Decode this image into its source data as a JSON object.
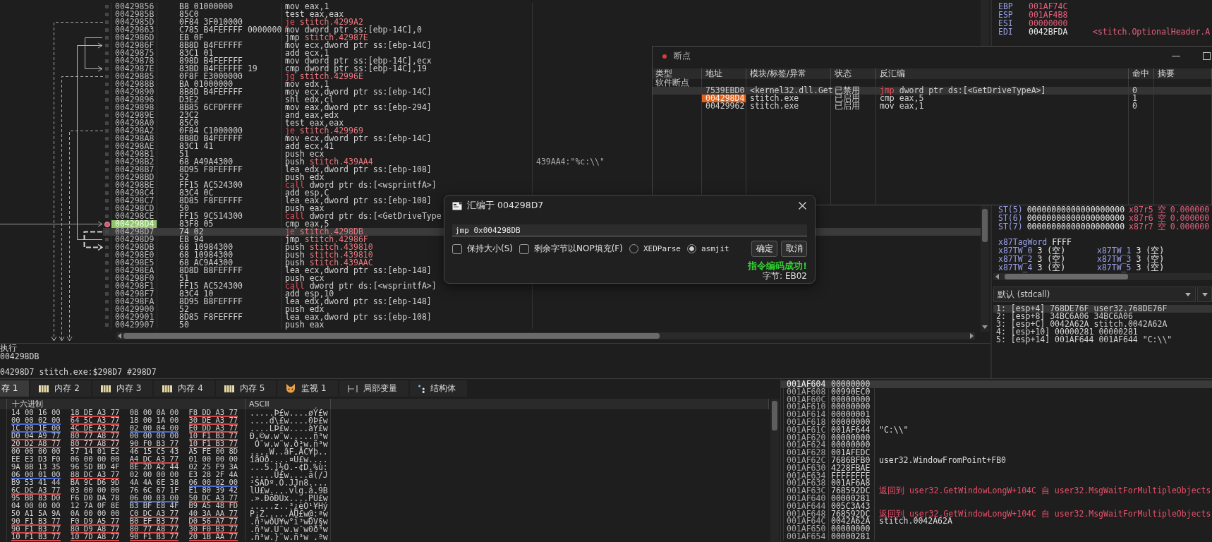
{
  "disassembly": {
    "rows": [
      {
        "address": "00429856",
        "bytes": "B8 01000000",
        "mnemonic": "mov",
        "operands": "eax,1",
        "kind": "plain",
        "breakpoint": false,
        "highlighted": false,
        "selected": false
      },
      {
        "address": "0042985B",
        "bytes": "85C0",
        "mnemonic": "test",
        "operands": "eax,eax",
        "kind": "plain",
        "breakpoint": false,
        "highlighted": false,
        "selected": false
      },
      {
        "address": "0042985D",
        "bytes": "0F84 3F010000",
        "mnemonic": "je",
        "operands": "stitch.4299A2",
        "kind": "cond_jump",
        "breakpoint": false,
        "highlighted": false,
        "selected": false
      },
      {
        "address": "00429863",
        "bytes": "C785 B4FEFFFF 0000000",
        "mnemonic": "mov",
        "operands": "dword ptr ss:[ebp-14C],0",
        "kind": "plain",
        "breakpoint": false,
        "highlighted": false,
        "selected": false
      },
      {
        "address": "0042986D",
        "bytes": "EB 0F",
        "mnemonic": "jmp",
        "operands": "stitch.42987E",
        "kind": "jump",
        "breakpoint": false,
        "highlighted": false,
        "selected": false
      },
      {
        "address": "0042986F",
        "bytes": "8B8D B4FEFFFF",
        "mnemonic": "mov",
        "operands": "ecx,dword ptr ss:[ebp-14C]",
        "kind": "plain",
        "breakpoint": false,
        "highlighted": false,
        "selected": false
      },
      {
        "address": "00429875",
        "bytes": "83C1 01",
        "mnemonic": "add",
        "operands": "ecx,1",
        "kind": "plain",
        "breakpoint": false,
        "highlighted": false,
        "selected": false
      },
      {
        "address": "00429878",
        "bytes": "898D B4FEFFFF",
        "mnemonic": "mov",
        "operands": "dword ptr ss:[ebp-14C],ecx",
        "kind": "plain",
        "breakpoint": false,
        "highlighted": false,
        "selected": false
      },
      {
        "address": "0042987E",
        "bytes": "83BD B4FEFFFF 19",
        "mnemonic": "cmp",
        "operands": "dword ptr ss:[ebp-14C],19",
        "kind": "plain",
        "breakpoint": false,
        "highlighted": false,
        "selected": false
      },
      {
        "address": "00429885",
        "bytes": "0F8F E3000000",
        "mnemonic": "jg",
        "operands": "stitch.42996E",
        "kind": "cond_jump",
        "breakpoint": false,
        "highlighted": false,
        "selected": false
      },
      {
        "address": "0042988B",
        "bytes": "BA 01000000",
        "mnemonic": "mov",
        "operands": "edx,1",
        "kind": "plain",
        "breakpoint": false,
        "highlighted": false,
        "selected": false
      },
      {
        "address": "00429890",
        "bytes": "8B8D B4FEFFFF",
        "mnemonic": "mov",
        "operands": "ecx,dword ptr ss:[ebp-14C]",
        "kind": "plain",
        "breakpoint": false,
        "highlighted": false,
        "selected": false
      },
      {
        "address": "00429896",
        "bytes": "D3E2",
        "mnemonic": "shl",
        "operands": "edx,cl",
        "kind": "plain",
        "breakpoint": false,
        "highlighted": false,
        "selected": false
      },
      {
        "address": "00429898",
        "bytes": "8B85 6CFDFFFF",
        "mnemonic": "mov",
        "operands": "eax,dword ptr ss:[ebp-294]",
        "kind": "plain",
        "breakpoint": false,
        "highlighted": false,
        "selected": false
      },
      {
        "address": "0042989E",
        "bytes": "23C2",
        "mnemonic": "and",
        "operands": "eax,edx",
        "kind": "plain",
        "breakpoint": false,
        "highlighted": false,
        "selected": false
      },
      {
        "address": "004298A0",
        "bytes": "85C0",
        "mnemonic": "test",
        "operands": "eax,eax",
        "kind": "plain",
        "breakpoint": false,
        "highlighted": false,
        "selected": false
      },
      {
        "address": "004298A2",
        "bytes": "0F84 C1000000",
        "mnemonic": "je",
        "operands": "stitch.429969",
        "kind": "cond_jump",
        "breakpoint": false,
        "highlighted": false,
        "selected": false
      },
      {
        "address": "004298A8",
        "bytes": "8B8D B4FEFFFF",
        "mnemonic": "mov",
        "operands": "ecx,dword ptr ss:[ebp-14C]",
        "kind": "plain",
        "breakpoint": false,
        "highlighted": false,
        "selected": false
      },
      {
        "address": "004298AE",
        "bytes": "83C1 41",
        "mnemonic": "add",
        "operands": "ecx,41",
        "kind": "plain",
        "breakpoint": false,
        "highlighted": false,
        "selected": false
      },
      {
        "address": "004298B1",
        "bytes": "51",
        "mnemonic": "push",
        "operands": "ecx",
        "kind": "plain",
        "breakpoint": false,
        "highlighted": false,
        "selected": false
      },
      {
        "address": "004298B2",
        "bytes": "68 A49A4300",
        "mnemonic": "push",
        "operands": "stitch.439AA4",
        "kind": "push_addr",
        "comment": "439AA4:\"%c:\\\\\"",
        "breakpoint": false,
        "highlighted": false,
        "selected": false
      },
      {
        "address": "004298B7",
        "bytes": "8D95 F8FEFFFF",
        "mnemonic": "lea",
        "operands": "edx,dword ptr ss:[ebp-108]",
        "kind": "plain",
        "breakpoint": false,
        "highlighted": false,
        "selected": false
      },
      {
        "address": "004298BD",
        "bytes": "52",
        "mnemonic": "push",
        "operands": "edx",
        "kind": "plain",
        "breakpoint": false,
        "highlighted": false,
        "selected": false
      },
      {
        "address": "004298BE",
        "bytes": "FF15 AC524300",
        "mnemonic": "call",
        "operands": "dword ptr ds:[<wsprintfA>]",
        "kind": "call",
        "breakpoint": false,
        "highlighted": false,
        "selected": false
      },
      {
        "address": "004298C4",
        "bytes": "83C4 0C",
        "mnemonic": "add",
        "operands": "esp,C",
        "kind": "plain",
        "breakpoint": false,
        "highlighted": false,
        "selected": false
      },
      {
        "address": "004298C7",
        "bytes": "8D85 F8FEFFFF",
        "mnemonic": "lea",
        "operands": "eax,dword ptr ss:[ebp-108]",
        "kind": "plain",
        "breakpoint": false,
        "highlighted": false,
        "selected": false
      },
      {
        "address": "004298CD",
        "bytes": "50",
        "mnemonic": "push",
        "operands": "eax",
        "kind": "plain",
        "breakpoint": false,
        "highlighted": false,
        "selected": false
      },
      {
        "address": "004298CE",
        "bytes": "FF15 9C514300",
        "mnemonic": "call",
        "operands": "dword ptr ds:[<GetDriveType",
        "kind": "call",
        "breakpoint": false,
        "highlighted": false,
        "selected": false
      },
      {
        "address": "004298D4",
        "bytes": "83F8 05",
        "mnemonic": "cmp",
        "operands": "eax,5",
        "kind": "plain",
        "breakpoint": true,
        "highlighted": true,
        "selected": false
      },
      {
        "address": "004298D7",
        "bytes": "74 02",
        "mnemonic": "je",
        "operands": "stitch.4298DB",
        "kind": "cond_jump",
        "breakpoint": false,
        "highlighted": false,
        "selected": true
      },
      {
        "address": "004298D9",
        "bytes": "EB 94",
        "mnemonic": "jmp",
        "operands": "stitch.42986F",
        "kind": "jump",
        "breakpoint": false,
        "highlighted": false,
        "selected": false
      },
      {
        "address": "004298DB",
        "bytes": "68 10984300",
        "mnemonic": "push",
        "operands": "stitch.439810",
        "kind": "push_addr",
        "breakpoint": false,
        "highlighted": false,
        "selected": false
      },
      {
        "address": "004298E0",
        "bytes": "68 10984300",
        "mnemonic": "push",
        "operands": "stitch.439810",
        "kind": "push_addr",
        "breakpoint": false,
        "highlighted": false,
        "selected": false
      },
      {
        "address": "004298E5",
        "bytes": "68 AC9A4300",
        "mnemonic": "push",
        "operands": "stitch.439AAC",
        "kind": "push_addr",
        "breakpoint": false,
        "highlighted": false,
        "selected": false
      },
      {
        "address": "004298EA",
        "bytes": "8D8D B8FEFFFF",
        "mnemonic": "lea",
        "operands": "ecx,dword ptr ss:[ebp-148]",
        "kind": "plain",
        "breakpoint": false,
        "highlighted": false,
        "selected": false
      },
      {
        "address": "004298F0",
        "bytes": "51",
        "mnemonic": "push",
        "operands": "ecx",
        "kind": "plain",
        "breakpoint": false,
        "highlighted": false,
        "selected": false
      },
      {
        "address": "004298F1",
        "bytes": "FF15 AC524300",
        "mnemonic": "call",
        "operands": "dword ptr ds:[<wsprintfA>]",
        "kind": "call",
        "breakpoint": false,
        "highlighted": false,
        "selected": false
      },
      {
        "address": "004298F7",
        "bytes": "83C4 10",
        "mnemonic": "add",
        "operands": "esp,10",
        "kind": "plain",
        "breakpoint": false,
        "highlighted": false,
        "selected": false
      },
      {
        "address": "004298FA",
        "bytes": "8D95 B8FEFFFF",
        "mnemonic": "lea",
        "operands": "edx,dword ptr ss:[ebp-148]",
        "kind": "plain",
        "breakpoint": false,
        "highlighted": false,
        "selected": false
      },
      {
        "address": "00429900",
        "bytes": "52",
        "mnemonic": "push",
        "operands": "edx",
        "kind": "plain",
        "breakpoint": false,
        "highlighted": false,
        "selected": false
      },
      {
        "address": "00429901",
        "bytes": "8D85 F8FEFFFF",
        "mnemonic": "lea",
        "operands": "eax,dword ptr ss:[ebp-108]",
        "kind": "plain",
        "breakpoint": false,
        "highlighted": false,
        "selected": false
      },
      {
        "address": "00429907",
        "bytes": "50",
        "mnemonic": "push",
        "operands": "eax",
        "kind": "plain",
        "breakpoint": false,
        "highlighted": false,
        "selected": false
      }
    ],
    "status_lines": [
      "执行",
      "004298DB",
      "04298D7 stitch.exe:$298D7 #298D7"
    ]
  },
  "registers": [
    {
      "name": "EBP",
      "value": "001AF74C",
      "changed": true
    },
    {
      "name": "ESP",
      "value": "001AF4B8",
      "changed": true
    },
    {
      "name": "ESI",
      "value": "00000000",
      "changed": true
    },
    {
      "name": "EDI",
      "value": "0042BFDA",
      "changed": false,
      "comment": "<stitch.OptionalHeader.A"
    }
  ],
  "breakpoints_window": {
    "title": "断点",
    "columns": [
      "类型",
      "地址",
      "模块/标签/异常",
      "状态",
      "反汇编",
      "命中",
      "摘要"
    ],
    "group": "软件断点",
    "rows": [
      {
        "address": "7539EBD0",
        "module": "<kernel32.dll.Get",
        "status": "已禁用",
        "mnemonic": "jmp",
        "operands": "dword ptr ds:[<GetDriveTypeA>]",
        "kind": "indirect_jump",
        "hits": "0",
        "selected": true,
        "highlighted": false
      },
      {
        "address": "004298D4",
        "module": "stitch.exe",
        "status": "已启用",
        "mnemonic": "cmp",
        "operands": "eax,5",
        "kind": "plain",
        "hits": "1",
        "selected": false,
        "highlighted": true
      },
      {
        "address": "00429962",
        "module": "stitch.exe",
        "status": "已启用",
        "mnemonic": "mov",
        "operands": "eax,1",
        "kind": "plain",
        "hits": "0",
        "selected": false,
        "highlighted": false
      }
    ]
  },
  "fpu": {
    "st": [
      {
        "name": "ST(5)",
        "value": "00000000000000000000",
        "tag_register": "x87r5",
        "tag": "空",
        "number": "0.000000"
      },
      {
        "name": "ST(6)",
        "value": "00000000000000000000",
        "tag_register": "x87r6",
        "tag": "空",
        "number": "0.000000"
      },
      {
        "name": "ST(7)",
        "value": "00000000000000000000",
        "tag_register": "x87r7",
        "tag": "空",
        "number": "0.000000"
      }
    ],
    "tag_word": {
      "label": "x87TagWord",
      "value": "FFFF"
    },
    "tags": [
      {
        "label": "x87TW_0",
        "value": "3 (空)"
      },
      {
        "label": "x87TW_1",
        "value": "3 (空)"
      },
      {
        "label": "x87TW_2",
        "value": "3 (空)"
      },
      {
        "label": "x87TW_3",
        "value": "3 (空)"
      },
      {
        "label": "x87TW_4",
        "value": "3 (空)"
      },
      {
        "label": "x87TW_5",
        "value": "3 (空)"
      }
    ]
  },
  "call_convention": {
    "value": "默认 (stdcall)"
  },
  "arguments": [
    {
      "text": "1: [esp+4] 768DE76F user32.768DE76F",
      "selected": true
    },
    {
      "text": "2: [esp+8] 34BC6A06 34BC6A06",
      "selected": false
    },
    {
      "text": "3: [esp+C] 0042A62A stitch.0042A62A",
      "selected": false
    },
    {
      "text": "4: [esp+10] 00000281 00000281",
      "selected": false
    },
    {
      "text": "5: [esp+14] 001AF644 001AF644 \"C:\\\\\"",
      "selected": false
    }
  ],
  "assemble_dialog": {
    "title": "汇编于 004298D7",
    "value": "jmp 0x004298DB",
    "checkboxes": [
      {
        "label": "保持大小(S)",
        "checked": false
      },
      {
        "label": "剩余字节以NOP填充(F)",
        "checked": false
      }
    ],
    "engines": [
      {
        "label": "XEDParse",
        "selected": false
      },
      {
        "label": "asmjit",
        "selected": true
      }
    ],
    "buttons": [
      "确定",
      "取消"
    ],
    "message": "指令编码成功!",
    "bytes": "字节: EB02"
  },
  "dump_tabs": [
    {
      "label": "存 1",
      "kind": "plain",
      "selected": true
    },
    {
      "label": "内存 2",
      "kind": "memory",
      "selected": false
    },
    {
      "label": "内存 3",
      "kind": "memory",
      "selected": false
    },
    {
      "label": "内存 4",
      "kind": "memory",
      "selected": false
    },
    {
      "label": "内存 5",
      "kind": "memory",
      "selected": false
    },
    {
      "label": "监视 1",
      "kind": "watch",
      "selected": false
    },
    {
      "label": "局部变量",
      "kind": "locals",
      "selected": false
    },
    {
      "label": "结构体",
      "kind": "struct",
      "selected": false
    }
  ],
  "dump": {
    "columns": [
      "十六进制",
      "ASCII"
    ],
    "rows": [
      {
        "groups": [
          {
            "bytes": "14 00 16 00"
          },
          {
            "bytes": "18 DE A3 77",
            "color": "#d04848"
          },
          {
            "bytes": "08 00 0A 00"
          },
          {
            "bytes": "F8 DD A3 77",
            "color": "#d04848"
          }
        ],
        "ascii": ".....Þ£w....øÝ£w"
      },
      {
        "groups": [
          {
            "bytes": "00 00 02 00",
            "color": "#4a6ad0"
          },
          {
            "bytes": "64 5C A3 77",
            "color": "#d04848"
          },
          {
            "bytes": "18 00 1A 00"
          },
          {
            "bytes": "30 DE A3 77",
            "color": "#d04848"
          }
        ],
        "ascii": "....d\\£w....0Þ£w"
      },
      {
        "groups": [
          {
            "bytes": "1C 00 1E 00",
            "color": "#4a6ad0"
          },
          {
            "bytes": "4C DE A3 77",
            "color": "#d04848"
          },
          {
            "bytes": "02 00 04 00",
            "color": "#4a6ad0"
          },
          {
            "bytes": "E0 DD A3 77",
            "color": "#d04848"
          }
        ],
        "ascii": "....LÞ£w....àÝ£w"
      },
      {
        "groups": [
          {
            "bytes": "D0 04 A9 77",
            "color": "#d04848"
          },
          {
            "bytes": "80 77 A8 77",
            "color": "#d04848"
          },
          {
            "bytes": "00 00 00 00"
          },
          {
            "bytes": "10 F1 B3 77",
            "color": "#d04848"
          }
        ],
        "ascii": "Ð.©w.w¨w.....ñ³w"
      },
      {
        "groups": [
          {
            "bytes": "20 D2 A8 77",
            "color": "#d04848"
          },
          {
            "bytes": "80 77 A8 77",
            "color": "#d04848"
          },
          {
            "bytes": "90 F0 B3 77",
            "color": "#d04848"
          },
          {
            "bytes": "10 F1 B3 77",
            "color": "#d04848"
          }
        ],
        "ascii": " Ò¨w.w¨w.ð³w.ñ³w"
      },
      {
        "groups": [
          {
            "bytes": "00 00 00 00"
          },
          {
            "bytes": "57 14 01 E2"
          },
          {
            "bytes": "46 15 C5 43"
          },
          {
            "bytes": "A5 FE 00 8D"
          }
        ],
        "ascii": "....W..âF.ÅC¥þ.."
      },
      {
        "groups": [
          {
            "bytes": "EE E3 D3 F0"
          },
          {
            "bytes": "06 00 00 00"
          },
          {
            "bytes": "A4 DC A3 77",
            "color": "#d04848"
          },
          {
            "bytes": "01 00 00 00"
          }
        ],
        "ascii": "îãÓð....¤Ü£w...."
      },
      {
        "groups": [
          {
            "bytes": "9A 8B 13 35"
          },
          {
            "bytes": "96 5D BD 4F"
          },
          {
            "bytes": "8E 2D A2 44"
          },
          {
            "bytes": "02 25 F9 3A"
          }
        ],
        "ascii": "...5.]½O.-¢D.%ù:"
      },
      {
        "groups": [
          {
            "bytes": "06 00 01 00",
            "color": "#4a6ad0"
          },
          {
            "bytes": "88 DC A3 77",
            "color": "#d04848"
          },
          {
            "bytes": "02 00 00 00"
          },
          {
            "bytes": "E3 28 2F 4A"
          }
        ],
        "ascii": ".....Ü£w....ã(/J"
      },
      {
        "groups": [
          {
            "bytes": "B9 53 41 44"
          },
          {
            "bytes": "BA 9C D6 9D"
          },
          {
            "bytes": "4A 4A 6E 38"
          },
          {
            "bytes": "06 00 02 00",
            "color": "#4a6ad0"
          }
        ],
        "ascii": "¹SADº.Ö.JJn8...."
      },
      {
        "groups": [
          {
            "bytes": "6C DC A3 77",
            "color": "#d04848"
          },
          {
            "bytes": "03 00 00 00"
          },
          {
            "bytes": "76 6C 67 1F"
          },
          {
            "bytes": "E1 80 39 42"
          }
        ],
        "ascii": "lÜ£w....vlg.á.9B"
      },
      {
        "groups": [
          {
            "bytes": "95 BB 83 D0"
          },
          {
            "bytes": "F6 D0 DA 78"
          },
          {
            "bytes": "06 00 03 00",
            "color": "#4a6ad0"
          },
          {
            "bytes": "50 DC A3 77",
            "color": "#d04848"
          }
        ],
        "ascii": ".».ÐöÐÚx....PÜ£w"
      },
      {
        "groups": [
          {
            "bytes": "04 00 00 00"
          },
          {
            "bytes": "12 7A 0F 8E"
          },
          {
            "bytes": "B3 BF E8 4F"
          },
          {
            "bytes": "B9 A5 48 FD"
          }
        ],
        "ascii": ".....z..³¿èO¹¥Hý"
      },
      {
        "groups": [
          {
            "bytes": "50 A1 5A 9A"
          },
          {
            "bytes": "0A 00 00 00"
          },
          {
            "bytes": "C0 DC A3 77",
            "color": "#d04848"
          },
          {
            "bytes": "40 3A AA 77",
            "color": "#d04848"
          }
        ],
        "ascii": "P¡Z.....ÀÜ£w@:ªw"
      },
      {
        "groups": [
          {
            "bytes": "90 F1 B3 77",
            "color": "#d04848"
          },
          {
            "bytes": "F0 D9 A5 77",
            "color": "#d04848"
          },
          {
            "bytes": "B0 EF B3 77",
            "color": "#d04848"
          },
          {
            "bytes": "D0 56 A7 77",
            "color": "#d04848"
          }
        ],
        "ascii": ".ñ³wðÙ¥w°ï³wÐV§w"
      },
      {
        "groups": [
          {
            "bytes": "90 F1 B3 77",
            "color": "#d04848"
          },
          {
            "bytes": "80 D9 A8 77",
            "color": "#d04848"
          },
          {
            "bytes": "80 77 A8 77",
            "color": "#d04848"
          },
          {
            "bytes": "30 F0 B3 77",
            "color": "#d04848"
          }
        ],
        "ascii": ".ñ³w.Ù¨w.w¨w0ð³w"
      },
      {
        "groups": [
          {
            "bytes": "10 F1 B3 77",
            "color": "#d04848"
          },
          {
            "bytes": "10 7D A8 77",
            "color": "#d04848"
          },
          {
            "bytes": "90 F1 B3 77",
            "color": "#d04848"
          },
          {
            "bytes": "20 1B AA 77",
            "color": "#d04848"
          }
        ],
        "ascii": ".ñ³w.}¨w.ñ³w .ªw"
      }
    ]
  },
  "stack": {
    "rows": [
      {
        "address": "001AF604",
        "value": "00000000",
        "selected": true
      },
      {
        "address": "001AF608",
        "value": "00990EC0",
        "selected": false
      },
      {
        "address": "001AF60C",
        "value": "00000000",
        "selected": false
      },
      {
        "address": "001AF610",
        "value": "00000000",
        "selected": false
      },
      {
        "address": "001AF614",
        "value": "00000001",
        "selected": false
      },
      {
        "address": "001AF618",
        "value": "00000000",
        "selected": false
      },
      {
        "address": "001AF61C",
        "value": "001AF644",
        "comment": {
          "text": "\"C:\\\\\"",
          "kind": "plain"
        },
        "selected": false
      },
      {
        "address": "001AF620",
        "value": "00000000",
        "selected": false
      },
      {
        "address": "001AF624",
        "value": "00000000",
        "selected": false
      },
      {
        "address": "001AF628",
        "value": "001AFEDC",
        "selected": false
      },
      {
        "address": "001AF62C",
        "value": "7686BFB0",
        "comment": {
          "text": "user32.WindowFromPoint+FB0",
          "kind": "plain"
        },
        "selected": false
      },
      {
        "address": "001AF630",
        "value": "4228FBAE",
        "selected": false
      },
      {
        "address": "001AF634",
        "value": "FFFFFFFE",
        "selected": false
      },
      {
        "address": "001AF638",
        "value": "001AF6A8",
        "selected": false
      },
      {
        "address": "001AF63C",
        "value": "768592DC",
        "comment": {
          "text": "返回到 user32.GetWindowLongW+104C 自 user32.MsgWaitForMultipleObjects",
          "kind": "return"
        },
        "selected": false
      },
      {
        "address": "001AF640",
        "value": "00000281",
        "selected": false
      },
      {
        "address": "001AF644",
        "value": "005C3A43",
        "selected": false
      },
      {
        "address": "001AF648",
        "value": "768592DC",
        "comment": {
          "text": "返回到 user32.GetWindowLongW+104C 自 user32.MsgWaitForMultipleObjects",
          "kind": "return"
        },
        "selected": false
      },
      {
        "address": "001AF64C",
        "value": "0042A62A",
        "comment": {
          "text": "stitch.0042A62A",
          "kind": "plain"
        },
        "selected": false
      },
      {
        "address": "001AF650",
        "value": "00000000",
        "selected": false
      },
      {
        "address": "001AF654",
        "value": "00000281",
        "selected": false
      }
    ]
  }
}
